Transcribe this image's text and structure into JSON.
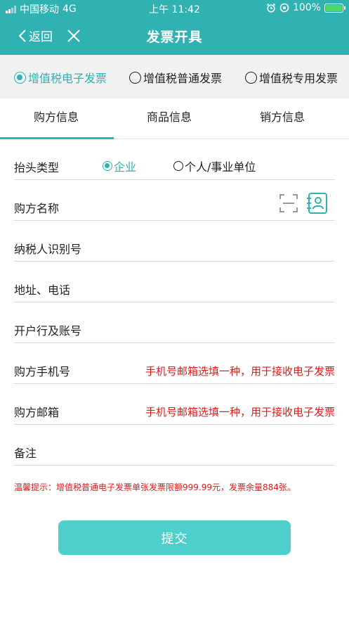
{
  "status_bar": {
    "carrier": "中国移动",
    "network": "4G",
    "time": "上午 11:42",
    "battery": "100%"
  },
  "nav": {
    "back_label": "返回",
    "title": "发票开具"
  },
  "invoice_types": [
    {
      "label": "增值税电子发票",
      "selected": true
    },
    {
      "label": "增值税普通发票",
      "selected": false
    },
    {
      "label": "增值税专用发票",
      "selected": false
    }
  ],
  "tabs": [
    {
      "label": "购方信息",
      "active": true
    },
    {
      "label": "商品信息",
      "active": false
    },
    {
      "label": "销方信息",
      "active": false
    }
  ],
  "form": {
    "header_type": {
      "label": "抬头类型",
      "options": [
        {
          "label": "企业",
          "selected": true
        },
        {
          "label": "个人/事业单位",
          "selected": false
        }
      ]
    },
    "buyer_name": {
      "label": "购方名称",
      "value": ""
    },
    "taxpayer_id": {
      "label": "纳税人识别号",
      "value": ""
    },
    "address_phone": {
      "label": "地址、电话",
      "value": ""
    },
    "bank_account": {
      "label": "开户行及账号",
      "value": ""
    },
    "buyer_phone": {
      "label": "购方手机号",
      "hint": "手机号邮箱选填一种，用于接收电子发票",
      "value": ""
    },
    "buyer_email": {
      "label": "购方邮箱",
      "hint": "手机号邮箱选填一种，用于接收电子发票",
      "value": ""
    },
    "remarks": {
      "label": "备注",
      "value": ""
    }
  },
  "tip": "温馨提示：增值税普通电子发票单张发票限额999.99元，发票余量884张。",
  "submit_label": "提交",
  "colors": {
    "primary": "#2fb2b1",
    "button": "#4ecfcc",
    "warning": "#e0191b"
  }
}
